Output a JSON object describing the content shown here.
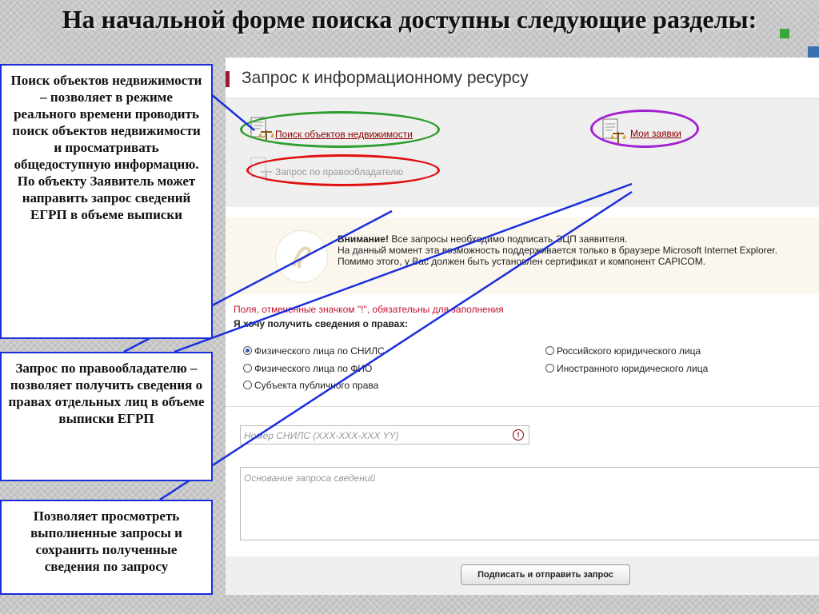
{
  "slide": {
    "title": "На начальной форме поиска доступны следующие разделы:"
  },
  "panel": {
    "header_title": "Запрос к информационному ресурсу",
    "links": {
      "search_objects": "Поиск объектов недвижимости",
      "my_requests": "Мои заявки",
      "owner_request": "Запрос по правообладателю"
    },
    "notice": {
      "bold": "Внимание!",
      "line1": " Все запросы необходимо подписать ЭЦП заявителя.",
      "line2": "На данный момент эта возможность поддерживается только в браузере Microsoft Internet Explorer.",
      "line3": "Помимо этого, у Вас должен быть установлен сертификат и компонент CAPICOM."
    },
    "required_note": "Поля, отмеченные значком \"!\", обязательны для заполнения",
    "want_label": "Я хочу получить сведения о правах:",
    "radios": [
      {
        "label": "Физического лица по СНИЛС",
        "selected": true
      },
      {
        "label": "Физического лица по ФИО",
        "selected": false
      },
      {
        "label": "Субъекта публичного права",
        "selected": false
      },
      {
        "label": "Российского юридического лица",
        "selected": false
      },
      {
        "label": "Иностранного юридического лица",
        "selected": false
      }
    ],
    "snils_placeholder": "Номер СНИЛС (XXX-XXX-XXX YY)",
    "warn_symbol": "!",
    "basis_placeholder": "Основание запроса сведений",
    "submit_label": "Подписать и отправить запрос"
  },
  "annotations": {
    "box1": "Поиск объектов недвижимости – позволяет в режиме реального времени проводить поиск объектов недвижимости и просматривать общедоступную информацию. По объекту Заявитель может направить запрос сведений ЕГРП в объеме выписки",
    "box2": "Запрос по правообладателю – позволяет получить сведения о правах отдельных лиц в объеме выписки ЕГРП",
    "box3": "Позволяет просмотреть выполненные запросы и сохранить полученные сведения по запросу"
  },
  "colors": {
    "annotation_border": "#1a2fdb",
    "oval_green": "#2e9e2e",
    "oval_red": "#e01010",
    "oval_purple": "#a020d0",
    "header_accent": "#9b1c2e"
  }
}
